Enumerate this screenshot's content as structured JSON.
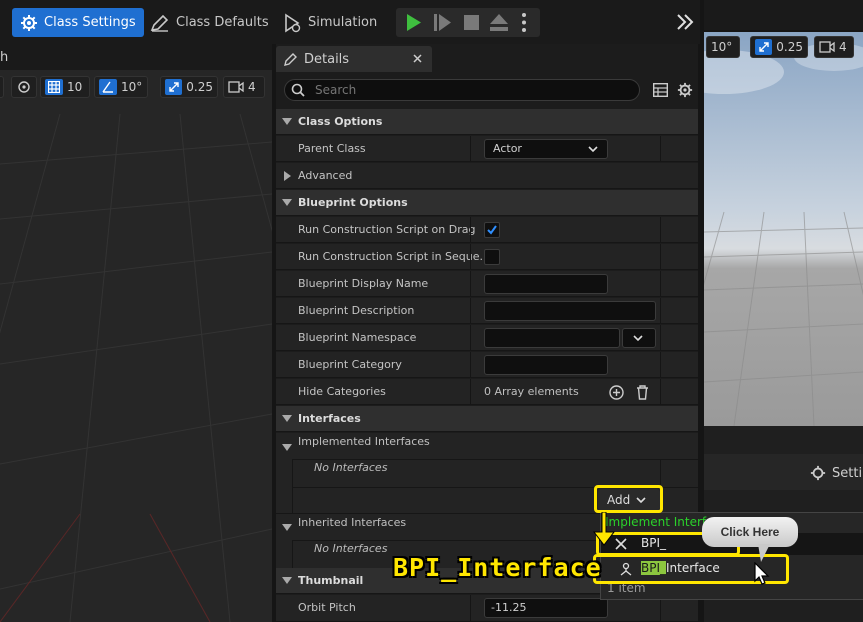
{
  "toolbar": {
    "class_settings": "Class Settings",
    "class_defaults": "Class Defaults",
    "simulation": "Simulation"
  },
  "left_viewport": {
    "partial_title": "h",
    "grid_value": "10",
    "angle_value": "10°",
    "scale_value": "0.25",
    "camera_value": "4"
  },
  "right_viewport": {
    "angle_value": "10°",
    "scale_value": "0.25",
    "camera_value": "4",
    "settings_label": "Setti"
  },
  "details": {
    "tab_title": "Details",
    "search_placeholder": "Search",
    "class_options": "Class Options",
    "parent_class_label": "Parent Class",
    "parent_class_value": "Actor",
    "advanced": "Advanced",
    "blueprint_options": "Blueprint Options",
    "run_construction_drag": "Run Construction Script on Drag",
    "run_construction_seq": "Run Construction Script in Seque...",
    "display_name": "Blueprint Display Name",
    "description": "Blueprint Description",
    "namespace": "Blueprint Namespace",
    "category": "Blueprint Category",
    "hide_categories": "Hide Categories",
    "array_elements": "0 Array elements",
    "interfaces": "Interfaces",
    "implemented": "Implemented Interfaces",
    "no_interfaces_1": "No Interfaces",
    "add": "Add",
    "inherited": "Inherited Interfaces",
    "no_interfaces_2": "No Interfaces",
    "thumbnail": "Thumbnail",
    "orbit_pitch": "Orbit Pitch",
    "orbit_pitch_value": "-11.25"
  },
  "popup": {
    "header": "Implement Interface",
    "search_value": "BPI_",
    "item_highlight": "BPI_",
    "item_rest": "Interface",
    "count": "1 item"
  },
  "annotation": {
    "label": "BPI_Interface",
    "bubble": "Click Here"
  },
  "colors": {
    "accent": "#1f6fd1",
    "highlight": "#ffe600",
    "popup_header": "#2bd12b",
    "play_green": "#3fbf3f"
  }
}
